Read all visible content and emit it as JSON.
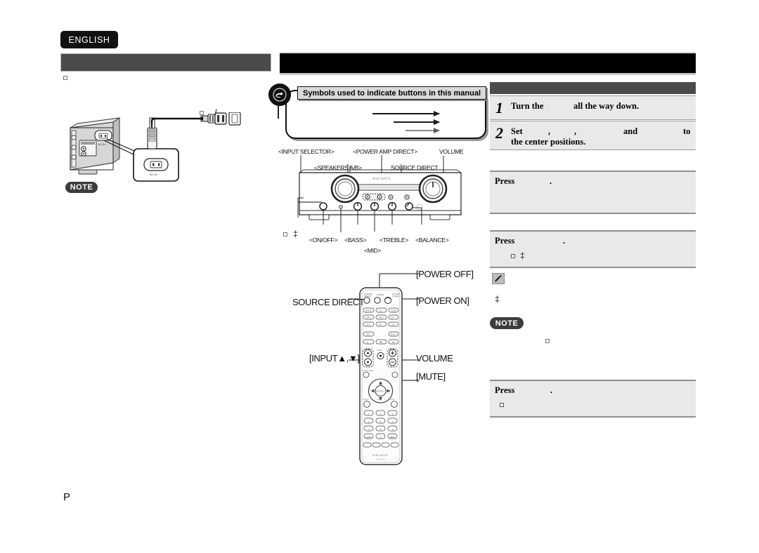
{
  "page": {
    "language_tab": "ENGLISH",
    "bottom_marker": "P"
  },
  "left_column": {
    "header_bar_label": "",
    "note_badge": "NOTE",
    "diagram": {
      "name": "rear-panel-ac-connection",
      "device_label": "AC IN  ~",
      "inset_label": "AC IN  ~"
    }
  },
  "middle_column": {
    "header_bar_label": "",
    "symbols_callout": {
      "title": "Symbols used to indicate buttons in this manual",
      "icon": "pointing-hand-icon",
      "arrows": [
        "",
        "",
        ""
      ]
    },
    "amplifier_diagram": {
      "name": "amplifier-front-panel",
      "brand": "marantz",
      "callouts_top": [
        "<INPUT SELECTOR>",
        "<SPEAKERS A/B>",
        "<POWER AMP DIRECT>",
        "SOURCE DIRECT",
        "VOLUME"
      ],
      "callouts_bottom": [
        "<ON/OFF>",
        "<BASS>",
        "<MID>",
        "<TREBLE>",
        "<BALANCE>"
      ]
    },
    "remote_diagram": {
      "name": "remote-control",
      "brand": "marantz",
      "model": "RC005PM",
      "callouts_left": [
        "SOURCE DIRECT",
        "[INPUT▲,▼]"
      ],
      "callouts_right": [
        "[POWER OFF]",
        "[POWER ON]",
        "VOLUME",
        "[MUTE]"
      ],
      "keypad": [
        "1",
        "2",
        "3",
        "4",
        "5",
        "6",
        "7",
        "8",
        "9",
        "CLEAR",
        "0",
        "MEMO"
      ]
    }
  },
  "right_column": {
    "header_bar_label": "",
    "steps": [
      {
        "number": "1",
        "line1_a": "Turn the",
        "line1_b": "all the way down.",
        "line2": ""
      },
      {
        "number": "2",
        "line1_a": "Set",
        "line1_b": ",",
        "line1_c": ",",
        "line1_d": "and",
        "line1_e": "to",
        "line2": "the center positions."
      }
    ],
    "press_blocks": [
      {
        "label": "Press",
        "suffix": ".",
        "sub": ""
      },
      {
        "label": "Press",
        "suffix": ".",
        "sub": ""
      },
      {
        "label": "Press",
        "suffix": ".",
        "sub": ""
      }
    ],
    "tip_badge_icon": "pencil-icon",
    "note_badge": "NOTE"
  }
}
